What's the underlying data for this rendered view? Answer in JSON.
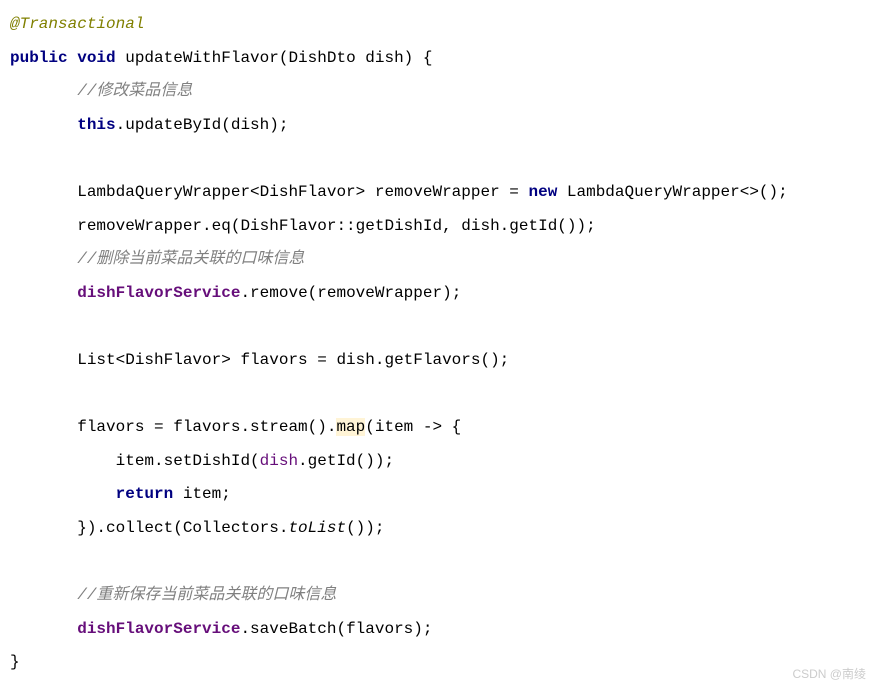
{
  "code": {
    "l1_annotation": "@Transactional",
    "l2_kw_public": "public",
    "l2_kw_void": "void",
    "l2_method": " updateWithFlavor(DishDto dish) {",
    "l3_indent": "       ",
    "l3_comment": "//修改菜品信息",
    "l4_indent": "       ",
    "l4_this": "this",
    "l4_rest": ".updateById(dish);",
    "blank": "",
    "l6_text": "       LambdaQueryWrapper<DishFlavor> removeWrapper = ",
    "l6_new": "new",
    "l6_rest": " LambdaQueryWrapper<>();",
    "l7_text": "       removeWrapper.eq(DishFlavor::getDishId, dish.getId());",
    "l8_indent": "       ",
    "l8_comment": "//删除当前菜品关联的口味信息",
    "l9_indent": "       ",
    "l9_field": "dishFlavorService",
    "l9_rest": ".remove(removeWrapper);",
    "l11_text": "       List<DishFlavor> flavors = dish.getFlavors();",
    "l13_a": "       flavors = flavors.stream().",
    "l13_map": "map",
    "l13_b": "(item -> {",
    "l14_a": "           item.setDishId(",
    "l14_param": "dish",
    "l14_b": ".getId());",
    "l15_indent": "           ",
    "l15_return": "return",
    "l15_rest": " item;",
    "l16_a": "       }).collect(Collectors.",
    "l16_static": "toList",
    "l16_b": "());",
    "l18_indent": "       ",
    "l18_comment": "//重新保存当前菜品关联的口味信息",
    "l19_indent": "       ",
    "l19_field": "dishFlavorService",
    "l19_rest": ".saveBatch(flavors);",
    "l20_close": "}"
  },
  "watermark": "CSDN @南绫"
}
